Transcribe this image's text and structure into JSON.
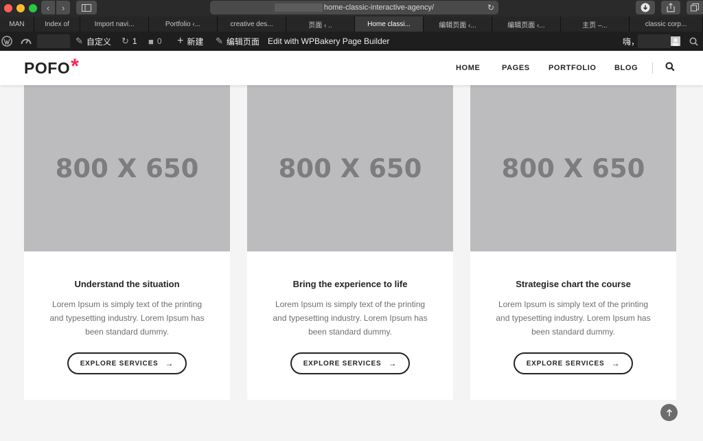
{
  "browser": {
    "url": "home-classic-interactive-agency/",
    "tabs": [
      {
        "label": "MAN",
        "active": false
      },
      {
        "label": "Index of",
        "active": false
      },
      {
        "label": "Import navi...",
        "active": false
      },
      {
        "label": "Portfolio ‹...",
        "active": false
      },
      {
        "label": "creative des...",
        "active": false
      },
      {
        "label": "页面 ‹ ..",
        "active": false
      },
      {
        "label": "Home classi...",
        "active": true
      },
      {
        "label": "编辑页面 ‹...",
        "active": false
      },
      {
        "label": "编辑页面 ‹...",
        "active": false
      },
      {
        "label": "主页 –...",
        "active": false
      },
      {
        "label": "classic corp...",
        "active": false
      }
    ]
  },
  "adminbar": {
    "customize": "自定义",
    "updates_count": "1",
    "comments_count": "0",
    "new": "新建",
    "edit_page": "编辑页面",
    "wpbakery": "Edit with WPBakery Page Builder",
    "greeting": "嗨，"
  },
  "header": {
    "logo": "POFO",
    "logo_mark": "*",
    "nav": [
      "HOME",
      "PAGES",
      "PORTFOLIO",
      "BLOG"
    ]
  },
  "cards": [
    {
      "image_text": "800 X 650",
      "title": "Understand the situation",
      "text": "Lorem Ipsum is simply text of the printing and typesetting industry. Lorem Ipsum has been standard dummy.",
      "button": "EXPLORE SERVICES"
    },
    {
      "image_text": "800 X 650",
      "title": "Bring the experience to life",
      "text": "Lorem Ipsum is simply text of the printing and typesetting industry. Lorem Ipsum has been standard dummy.",
      "button": "EXPLORE SERVICES"
    },
    {
      "image_text": "800 X 650",
      "title": "Strategise chart the course",
      "text": "Lorem Ipsum is simply text of the printing and typesetting industry. Lorem Ipsum has been standard dummy.",
      "button": "EXPLORE SERVICES"
    }
  ],
  "colors": {
    "accent": "#ff214f",
    "placeholder_bg": "#bcbbbd",
    "text_dark": "#232323",
    "adminbar_bg": "#1e1e1e"
  },
  "icons": {
    "back": "chevron-left-icon",
    "forward": "chevron-right-icon",
    "sidebar": "sidebar-icon",
    "reload": "reload-icon",
    "download": "download-icon",
    "share": "share-icon",
    "tabs": "tabs-overview-icon",
    "wordpress": "wordpress-icon",
    "dashboard": "dashboard-icon",
    "brush": "brush-icon",
    "updates": "updates-icon",
    "comments": "comment-icon",
    "plus": "plus-icon",
    "pencil": "pencil-icon",
    "search": "search-icon",
    "arrow": "arrow-right-icon",
    "scroll_top": "arrow-up-icon"
  }
}
